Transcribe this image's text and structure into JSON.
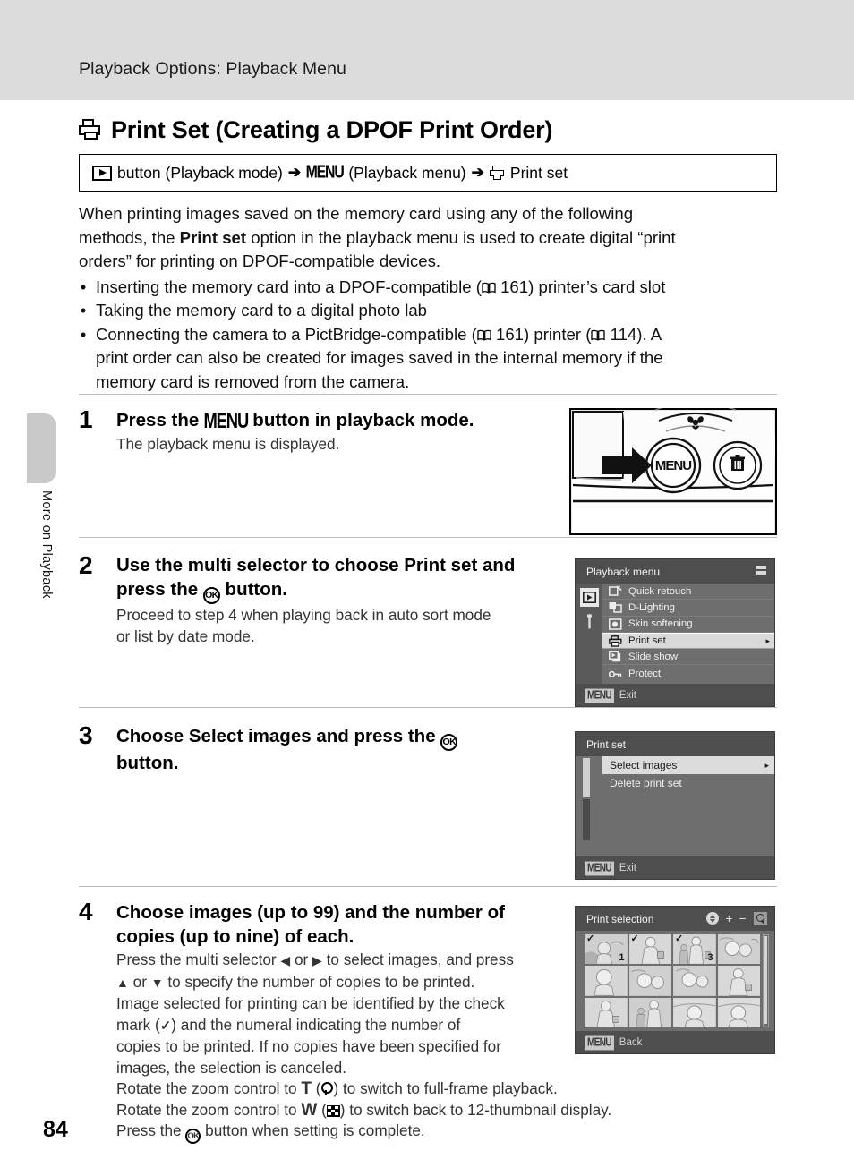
{
  "header": {
    "running_title": "Playback Options: Playback Menu"
  },
  "side_tab": {
    "label": "More on Playback"
  },
  "title": {
    "icon": "printer-icon",
    "text": "Print Set (Creating a DPOF Print Order)"
  },
  "nav_path": {
    "play_button_icon": "playback-button-icon",
    "part1": "button (Playback mode)",
    "arrow1": "➔",
    "menu_label": "MENU",
    "part2": "(Playback menu)",
    "arrow2": "➔",
    "printer_icon": "printer-icon",
    "part3": "Print set"
  },
  "intro": {
    "line1": "When printing images saved on the memory card using any of the following",
    "line2_a": "methods, the ",
    "line2_bold": "Print set",
    "line2_b": " option in the playback menu is used to create digital “print",
    "line3": "orders” for printing on DPOF-compatible devices.",
    "bullets": [
      {
        "pre": "Inserting the memory card into a DPOF-compatible (",
        "ref": "161",
        "post": ") printer’s card slot"
      },
      {
        "pre": "Taking the memory card to a digital photo lab",
        "ref": "",
        "post": ""
      },
      {
        "pre": "Connecting the camera to a PictBridge-compatible (",
        "ref": "161",
        "mid": ") printer (",
        "ref2": "114",
        "post": "). A"
      }
    ],
    "bullet3_line2": "print order can also be created for images saved in the internal memory if the",
    "bullet3_line3": "memory card is removed from the camera."
  },
  "steps": [
    {
      "number": "1",
      "head_a": "Press the ",
      "head_menu": "MENU",
      "head_b": " button in playback mode.",
      "sub": "The playback menu is displayed."
    },
    {
      "number": "2",
      "head_a": "Use the multi selector to choose ",
      "head_bold": "Print set",
      "head_b": " and",
      "head_line2_a": "press the ",
      "head_ok": "OK",
      "head_line2_b": " button.",
      "sub_line1": "Proceed to step 4 when playing back in auto sort mode",
      "sub_line2": "or list by date mode."
    },
    {
      "number": "3",
      "head_a": "Choose ",
      "head_bold": "Select images",
      "head_b": " and press the ",
      "head_ok": "OK",
      "head_line2": "button."
    },
    {
      "number": "4",
      "head_line1": "Choose images (up to 99) and the number of",
      "head_line2": "copies (up to nine) of each.",
      "body": [
        "Press the multi selector ◀ or ▶ to select images, and press",
        "▲ or ▼ to specify the number of copies to be printed.",
        "Image selected for printing can be identified by the check",
        "mark (✔) and the numeral indicating the number of",
        "copies to be printed. If no copies have been specified for",
        "images, the selection is canceled.",
        "Rotate the zoom control to T (⌕) to switch to full-frame playback.",
        "Rotate the zoom control to W (▦) to switch back to 12-thumbnail display.",
        "Press the OK button when setting is complete."
      ]
    }
  ],
  "camera_figure": {
    "menu_button_label": "MENU",
    "delete_button_icon": "trash-icon",
    "macro_icon": "macro-flower-icon",
    "pointer_icon": "arrow-right-icon"
  },
  "lcd_playback_menu": {
    "title": "Playback menu",
    "tabs": [
      {
        "icon": "playback-tab-icon",
        "active": true
      },
      {
        "icon": "setup-wrench-icon",
        "active": false
      }
    ],
    "items": [
      {
        "label": "Quick retouch",
        "icon": "quick-retouch-icon",
        "selected": false
      },
      {
        "label": "D-Lighting",
        "icon": "d-lighting-icon",
        "selected": false
      },
      {
        "label": "Skin softening",
        "icon": "skin-softening-icon",
        "selected": false
      },
      {
        "label": "Print set",
        "icon": "printer-icon",
        "selected": true
      },
      {
        "label": "Slide show",
        "icon": "slide-show-icon",
        "selected": false
      },
      {
        "label": "Protect",
        "icon": "key-protect-icon",
        "selected": false
      }
    ],
    "footer": {
      "chip": "MENU",
      "label": "Exit"
    }
  },
  "lcd_print_set": {
    "title": "Print set",
    "items": [
      {
        "label": "Select images",
        "selected": true
      },
      {
        "label": "Delete print set",
        "selected": false
      }
    ],
    "footer": {
      "chip": "MENU",
      "label": "Exit"
    }
  },
  "lcd_print_selection": {
    "title": "Print selection",
    "thumbnails": [
      {
        "check": true,
        "count": "1",
        "art": "bride"
      },
      {
        "check": true,
        "count": "",
        "art": "woman-bag"
      },
      {
        "check": true,
        "count": "3",
        "art": "couple-child"
      },
      {
        "check": false,
        "count": "",
        "art": "flowers"
      },
      {
        "check": false,
        "count": "",
        "art": "portrait"
      },
      {
        "check": false,
        "count": "",
        "art": "flowers"
      },
      {
        "check": false,
        "count": "",
        "art": "flowers"
      },
      {
        "check": false,
        "count": "",
        "art": "woman-bag"
      },
      {
        "check": false,
        "count": "",
        "art": "woman-bag"
      },
      {
        "check": false,
        "count": "",
        "art": "couple-child"
      },
      {
        "check": false,
        "count": "",
        "art": "landscape"
      },
      {
        "check": false,
        "count": "",
        "art": "landscape"
      }
    ],
    "footer": {
      "chip": "MENU",
      "label": "Back",
      "hint_updown": "up-down-icon",
      "hint_plus": "+",
      "hint_minus": "−",
      "hint_zoom": "magnifier-icon"
    }
  },
  "page_number": "84"
}
